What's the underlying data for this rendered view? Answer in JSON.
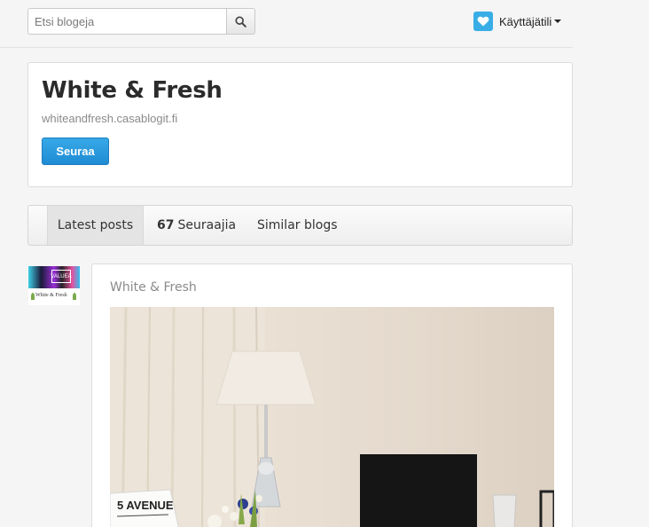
{
  "search": {
    "placeholder": "Etsi blogeja",
    "value": ""
  },
  "account": {
    "label": "Käyttäjätili"
  },
  "blog": {
    "title": "White & Fresh",
    "url": "whiteandfresh.casablogit.fi",
    "follow_label": "Seuraa"
  },
  "tabs": {
    "latest": "Latest posts",
    "followers_count": "67",
    "followers_label": "Seuraajia",
    "similar": "Similar blogs"
  },
  "thumbnail": {
    "badge": "VALUEA",
    "caption": "White & Fresh"
  },
  "post": {
    "blog_name": "White & Fresh",
    "image_text": "5 AVENUE"
  },
  "colors": {
    "accent": "#1f8bd3",
    "heart_bg": "#39aee6",
    "background": "#f5f5f5"
  },
  "icons": {
    "search": "search-icon",
    "heart": "heart-icon",
    "caret": "caret-down-icon"
  }
}
